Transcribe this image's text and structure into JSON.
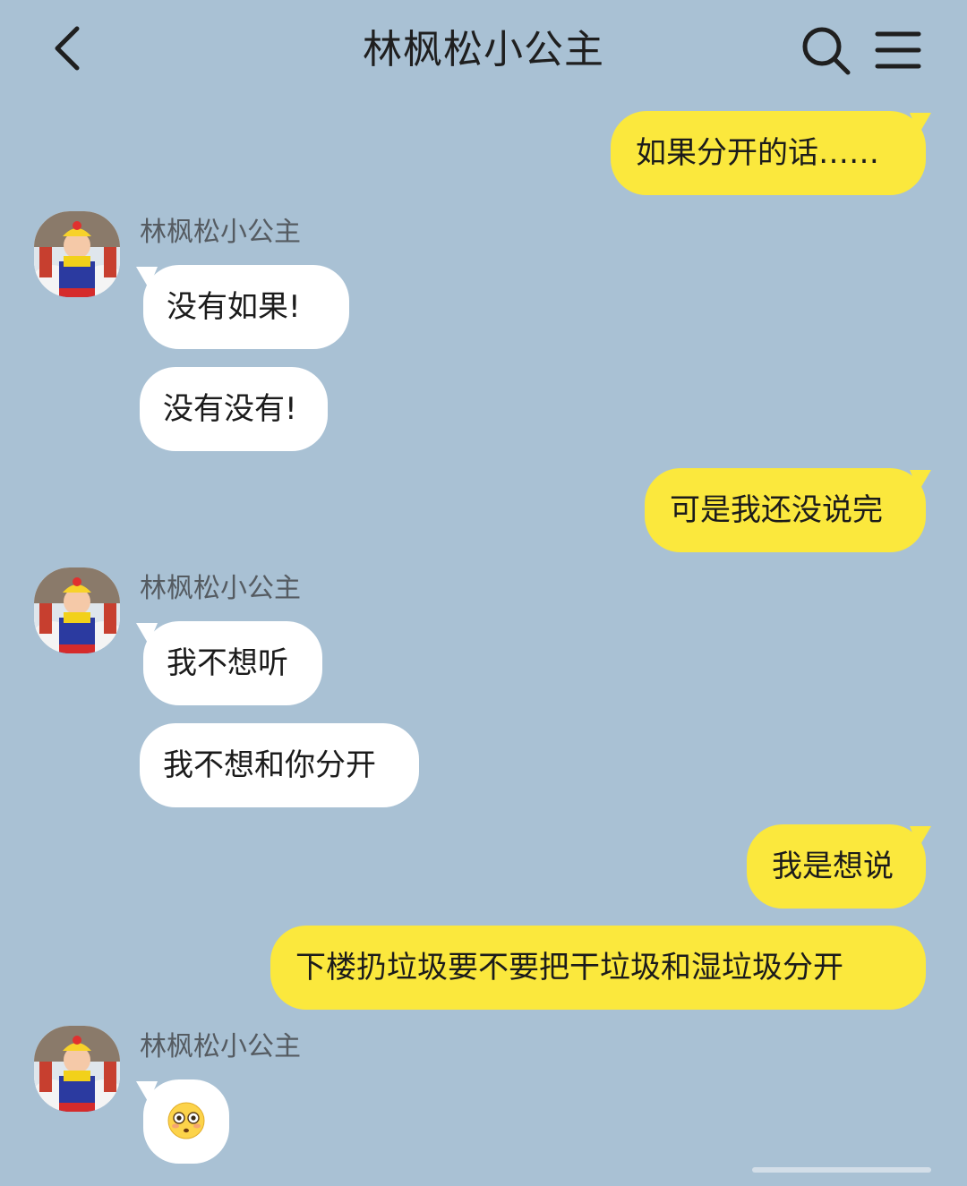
{
  "header": {
    "title": "林枫松小公主"
  },
  "messages": [
    {
      "side": "me",
      "text": "如果分开的话……"
    },
    {
      "side": "other",
      "sender": "林枫松小公主",
      "text": "没有如果!"
    },
    {
      "side": "other",
      "text": "没有没有!"
    },
    {
      "side": "me",
      "text": "可是我还没说完"
    },
    {
      "side": "other",
      "sender": "林枫松小公主",
      "text": "我不想听"
    },
    {
      "side": "other",
      "text": "我不想和你分开"
    },
    {
      "side": "me",
      "text": "我是想说"
    },
    {
      "side": "me",
      "text": "下楼扔垃圾要不要把干垃圾和湿垃圾分开"
    },
    {
      "side": "other",
      "sender": "林枫松小公主",
      "emoji": "flushed-face"
    }
  ],
  "colors": {
    "background": "#a9c1d4",
    "my_bubble": "#fbe83d",
    "other_bubble": "#ffffff",
    "sender_text": "#555b61"
  },
  "icons": {
    "back": "chevron-left-icon",
    "search": "search-icon",
    "menu": "menu-icon"
  }
}
